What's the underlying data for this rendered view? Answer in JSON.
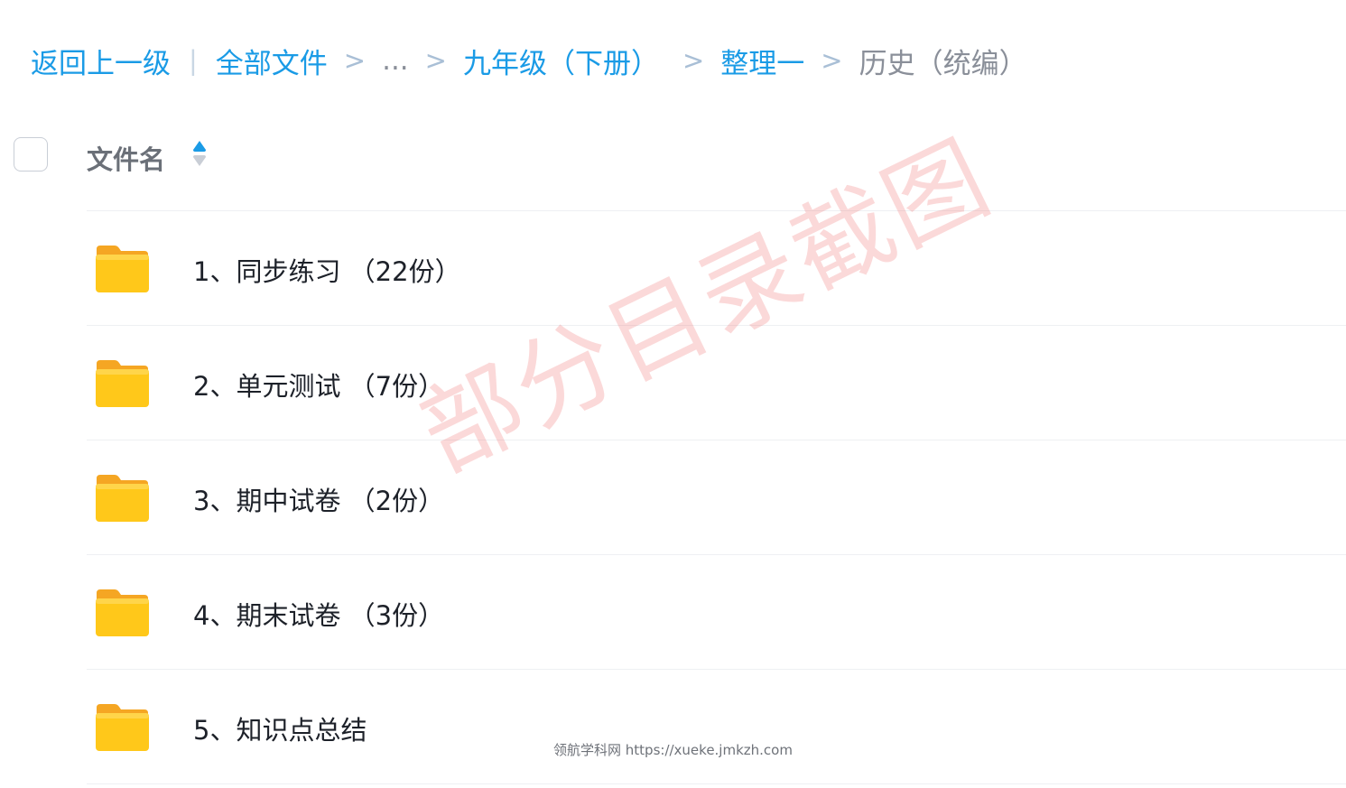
{
  "breadcrumb": {
    "back": "返回上一级",
    "separator_bar": "|",
    "all_files": "全部文件",
    "sep": ">",
    "ellipsis": "...",
    "level1": "九年级（下册）",
    "level2": "整理一",
    "current": "历史（统编）"
  },
  "header": {
    "column_title": "文件名"
  },
  "rows": [
    {
      "label": "1、同步练习 （22份）"
    },
    {
      "label": "2、单元测试 （7份）"
    },
    {
      "label": "3、期中试卷 （2份）"
    },
    {
      "label": "4、期末试卷 （3份）"
    },
    {
      "label": "5、知识点总结"
    }
  ],
  "watermark": "部分目录截图",
  "footer": "领航学科网 https://xueke.jmkzh.com",
  "colors": {
    "link": "#1a9be6",
    "folder": "#ffc81a",
    "watermark": "#f07878"
  }
}
